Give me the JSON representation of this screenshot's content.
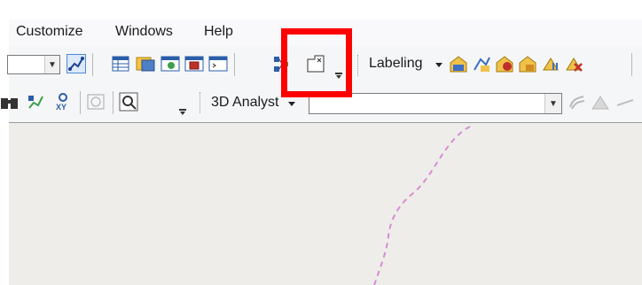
{
  "menu": {
    "items": [
      {
        "label": "Customize"
      },
      {
        "label": "Windows"
      },
      {
        "label": "Help"
      }
    ]
  },
  "toolbar_top": {
    "labeling_label": "Labeling",
    "labeling_dropdown_icon": "caret-down-icon"
  },
  "toolbar_bottom": {
    "analyst_label": "3D Analyst",
    "analyst_dropdown_icon": "caret-down-icon",
    "layer_select_value": ""
  },
  "colors": {
    "highlight": "#ff0000",
    "toolbar_bg": "#f5f6f8",
    "map_bg": "#efede9",
    "boundary": "#d68cd6"
  }
}
